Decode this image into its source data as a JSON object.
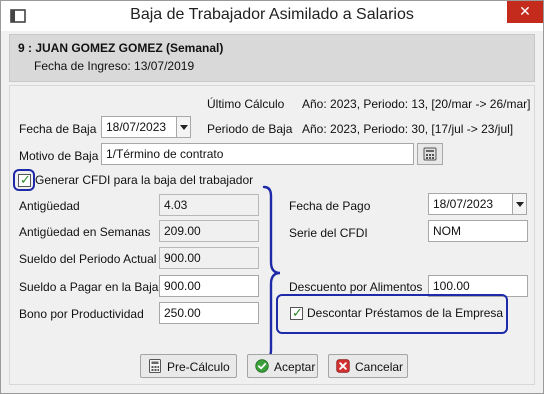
{
  "window": {
    "title": "Baja de Trabajador Asimilado a Salarios",
    "close_glyph": "✕"
  },
  "employee": {
    "name": "9 : JUAN GOMEZ GOMEZ (Semanal)",
    "hire_date": "Fecha de Ingreso: 13/07/2019"
  },
  "ultimo_calculo": {
    "label": "Último Cálculo",
    "value": "Año: 2023, Periodo: 13, [20/mar -> 26/mar]"
  },
  "fecha_baja": {
    "label": "Fecha de Baja",
    "value": "18/07/2023"
  },
  "periodo_baja": {
    "label": "Periodo de Baja",
    "value": "Año: 2023, Periodo: 30, [17/jul -> 23/jul]"
  },
  "motivo_baja": {
    "label": "Motivo de Baja",
    "value": "1/Término de contrato"
  },
  "generar_cfdi": {
    "label": "Generar CFDI para la baja del trabajador",
    "checked": true
  },
  "left_fields": {
    "antiguedad": {
      "label": "Antigüedad",
      "value": "4.03"
    },
    "antiguedad_semanas": {
      "label": "Antigüedad en Semanas",
      "value": "209.00"
    },
    "sueldo_periodo": {
      "label": "Sueldo del Periodo Actual",
      "value": "900.00"
    },
    "sueldo_pagar": {
      "label": "Sueldo a Pagar en la Baja",
      "value": "900.00"
    },
    "bono_productividad": {
      "label": "Bono por Productividad",
      "value": "250.00"
    }
  },
  "right_fields": {
    "fecha_pago": {
      "label": "Fecha de Pago",
      "value": "18/07/2023"
    },
    "serie_cfdi": {
      "label": "Serie del CFDI",
      "value": "NOM"
    },
    "descuento_alimentos": {
      "label": "Descuento por Alimentos",
      "value": "100.00"
    }
  },
  "descontar_prestamos": {
    "label": "Descontar Préstamos de la Empresa",
    "checked": true
  },
  "buttons": {
    "precalculo": "Pre-Cálculo",
    "aceptar": "Aceptar",
    "cancelar": "Cancelar"
  },
  "colors": {
    "highlight": "#1f2aa8",
    "close": "#c42b1c",
    "check": "#2a8a2a",
    "cancel": "#d23030"
  },
  "icons": [
    "app-icon",
    "calculator-icon",
    "checkmark-icon",
    "accept-icon",
    "cancel-icon",
    "dropdown-arrow-icon"
  ]
}
